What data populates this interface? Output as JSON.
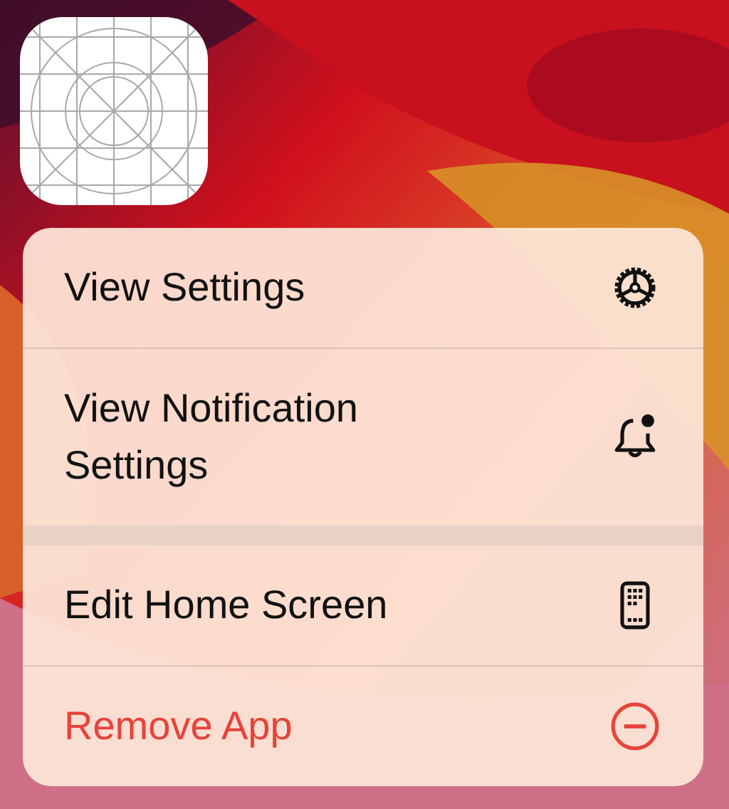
{
  "menu": {
    "groups": [
      {
        "items": [
          {
            "label": "View Settings",
            "destructive": false
          },
          {
            "label": "View Notification Settings",
            "destructive": false
          }
        ]
      },
      {
        "items": [
          {
            "label": "Edit Home Screen",
            "destructive": false
          },
          {
            "label": "Remove App",
            "destructive": true
          }
        ]
      }
    ]
  }
}
